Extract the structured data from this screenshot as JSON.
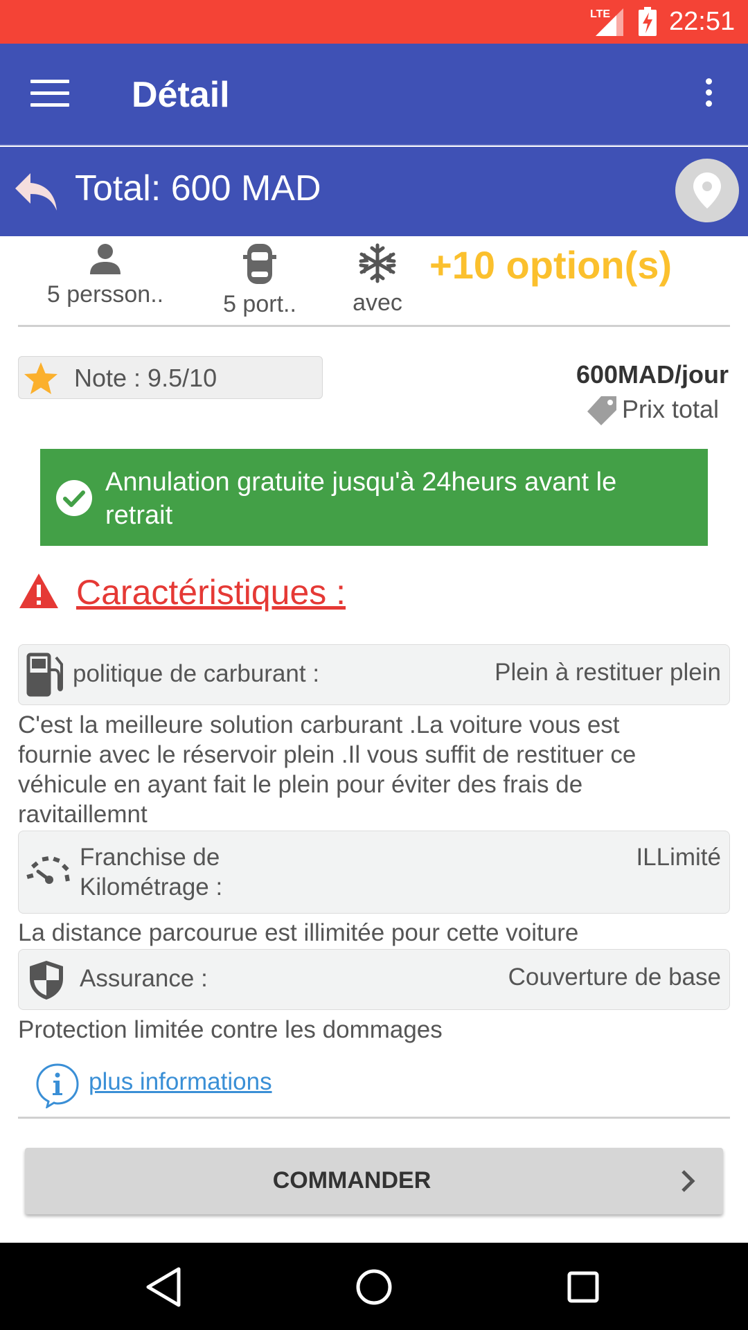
{
  "status_bar": {
    "network": "LTE",
    "time": "22:51",
    "icons": [
      "signal-icon",
      "battery-charging-icon"
    ]
  },
  "app_bar": {
    "title": "Détail",
    "icons": [
      "hamburger-menu-icon",
      "more-vert-icon"
    ]
  },
  "total_bar": {
    "total": "Total: 600 MAD",
    "icons": [
      "back-arrow-icon",
      "location-pin-icon"
    ]
  },
  "features": {
    "persons": "5 persson..",
    "doors": "5 port..",
    "ac": "avec",
    "options": "+10 option(s)",
    "icons": [
      "person-icon",
      "car-icon",
      "snowflake-icon"
    ]
  },
  "rating": {
    "note": "Note : 9.5/10",
    "icon": "star-icon",
    "star_color": "#fbb02d"
  },
  "pricing": {
    "price": "600MAD/jour",
    "label": "Prix total",
    "icon": "price-tag-icon"
  },
  "banner": {
    "text": "Annulation gratuite jusqu'à 24heurs avant le retrait",
    "icon": "check-circle-icon",
    "color": "#43a047"
  },
  "characteristics": {
    "title": "Caractéristiques :",
    "title_color": "#e53935",
    "icon": "warning-icon",
    "items": [
      {
        "label": "politique de carburant :",
        "value": "Plein à restituer plein",
        "description": "C'est la meilleure solution carburant .La voiture vous est fournie avec le réservoir plein .Il vous suffit de restituer ce véhicule en ayant fait le plein pour éviter des frais de ravitaillemnt",
        "icon": "fuel-pump-icon"
      },
      {
        "label": "Franchise de Kilométrage :",
        "value": "ILLimité",
        "description": "La distance parcourue est illimitée pour cette voiture",
        "icon": "speedometer-icon"
      },
      {
        "label": "Assurance :",
        "value": "Couverture de base",
        "description": "Protection limitée contre les dommages",
        "icon": "shield-icon"
      }
    ]
  },
  "more_info": {
    "label": "plus informations",
    "icon": "info-icon",
    "link_color": "#3a8fd6"
  },
  "order_button": {
    "label": "COMMANDER",
    "icon": "chevron-right-icon"
  },
  "nav_bar": {
    "icons": [
      "nav-back-icon",
      "nav-home-icon",
      "nav-recents-icon"
    ]
  },
  "colors": {
    "status_bar": "#f44336",
    "primary": "#3f51b5",
    "accent": "#fbc02d"
  }
}
